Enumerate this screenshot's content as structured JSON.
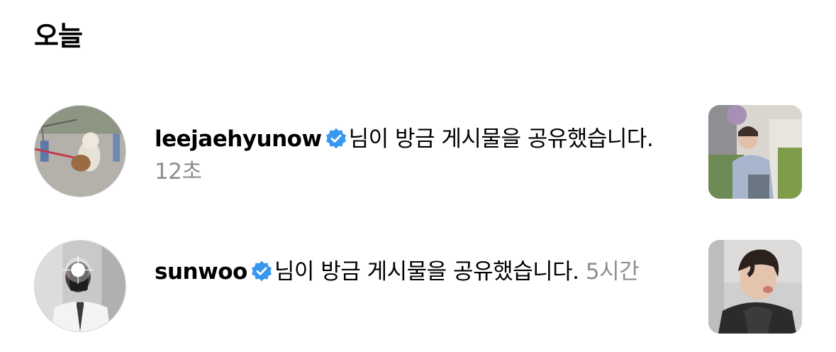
{
  "section": {
    "title": "오늘"
  },
  "notifications": [
    {
      "username": "leejaehyunow",
      "verified": true,
      "message": "님이 방금 게시물을 공유했습니다.",
      "time": "12초",
      "avatar_icon": "dog-photo-avatar",
      "thumbnail_icon": "person-photo-thumbnail"
    },
    {
      "username": "sunwoo",
      "verified": true,
      "message": "님이 방금 게시물을 공유했습니다.",
      "time": "5시간",
      "avatar_icon": "mirror-selfie-avatar",
      "thumbnail_icon": "person-photo-thumbnail"
    }
  ],
  "colors": {
    "verified_badge": "#3897f0",
    "timestamp": "#8e8e8e",
    "avatar_border": "#d7d7d7"
  }
}
